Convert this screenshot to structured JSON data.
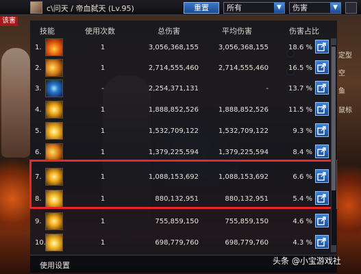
{
  "topbar": {
    "character_name": "c\\问天 / 帝血弑天 (Lv.95)",
    "reset_label": "重置",
    "filter_select": "所有",
    "metric_select": "伤害"
  },
  "side": {
    "tag": "该害",
    "options": [
      "定型",
      "空",
      "鱼"
    ],
    "extra": "鼠标"
  },
  "table": {
    "headers": {
      "skill": "技能",
      "uses": "使用次数",
      "total": "总伤害",
      "avg": "平均伤害",
      "share": "伤害占比"
    },
    "rows": [
      {
        "index": "1.",
        "uses": "1",
        "total": "3,056,368,155",
        "avg": "3,056,368,155",
        "pct": "18.6 %",
        "icon": "fire-skill-icon"
      },
      {
        "index": "2.",
        "uses": "1",
        "total": "2,714,555,460",
        "avg": "2,714,555,460",
        "pct": "16.5 %",
        "icon": "claw-skill-icon"
      },
      {
        "index": "3.",
        "uses": "-",
        "total": "2,254,371,131",
        "avg": "-",
        "pct": "13.7 %",
        "icon": "eye-skill-icon"
      },
      {
        "index": "4.",
        "uses": "1",
        "total": "1,888,852,526",
        "avg": "1,888,852,526",
        "pct": "11.5 %",
        "icon": "star-skill-icon"
      },
      {
        "index": "5.",
        "uses": "1",
        "total": "1,532,709,122",
        "avg": "1,532,709,122",
        "pct": "9.3 %",
        "icon": "burst-skill-icon"
      },
      {
        "index": "6.",
        "uses": "1",
        "total": "1,379,225,594",
        "avg": "1,379,225,594",
        "pct": "8.4 %",
        "icon": "claw-skill-icon"
      },
      {
        "index": "7.",
        "uses": "1",
        "total": "1,088,153,692",
        "avg": "1,088,153,692",
        "pct": "6.6 %",
        "icon": "star-skill-icon"
      },
      {
        "index": "8.",
        "uses": "1",
        "total": "880,132,951",
        "avg": "880,132,951",
        "pct": "5.4 %",
        "icon": "burst-skill-icon"
      },
      {
        "index": "9.",
        "uses": "1",
        "total": "755,859,150",
        "avg": "755,859,150",
        "pct": "4.6 %",
        "icon": "star-skill-icon"
      },
      {
        "index": "10.",
        "uses": "1",
        "total": "698,779,760",
        "avg": "698,779,760",
        "pct": "4.3 %",
        "icon": "burst-skill-icon"
      }
    ]
  },
  "footer": {
    "settings_label": "使用设置"
  },
  "watermark": "头条 @小宝游戏社",
  "colors": {
    "highlight": "#e82828",
    "accent": "#2a62b8"
  }
}
